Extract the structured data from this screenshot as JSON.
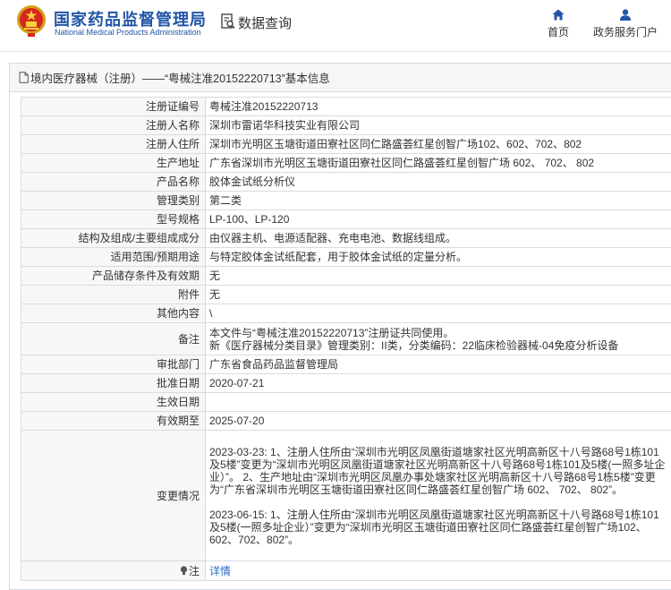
{
  "header": {
    "brand_cn": "国家药品监督管理局",
    "brand_en": "National Medical Products Administration",
    "page_heading": "数据查询",
    "nav": [
      {
        "label": "首页",
        "icon": "home-icon"
      },
      {
        "label": "政务服务门户",
        "icon": "user-icon"
      }
    ]
  },
  "panel": {
    "title": "境内医疗器械（注册）——“粤械注准20152220713”基本信息"
  },
  "fields": {
    "reg_no": {
      "label": "注册证编号",
      "value": "粤械注准20152220713"
    },
    "registrant": {
      "label": "注册人名称",
      "value": "深圳市雷诺华科技实业有限公司"
    },
    "registrant_addr": {
      "label": "注册人住所",
      "value": "深圳市光明区玉塘街道田寮社区同仁路盛荟红星创智广场102、602、702、802"
    },
    "production_addr": {
      "label": "生产地址",
      "value": "广东省深圳市光明区玉塘街道田寮社区同仁路盛荟红星创智广场 602、 702、 802"
    },
    "product_name": {
      "label": "产品名称",
      "value": "胶体金试纸分析仪"
    },
    "category": {
      "label": "管理类别",
      "value": "第二类"
    },
    "model": {
      "label": "型号规格",
      "value": "LP-100、LP-120"
    },
    "structure": {
      "label": "结构及组成/主要组成成分",
      "value": "由仪器主机、电源适配器、充电电池、数据线组成。"
    },
    "scope": {
      "label": "适用范围/预期用途",
      "value": "与特定胶体金试纸配套，用于胶体金试纸的定量分析。"
    },
    "storage": {
      "label": "产品储存条件及有效期",
      "value": "无"
    },
    "attachment": {
      "label": "附件",
      "value": "无"
    },
    "other": {
      "label": "其他内容",
      "value": "\\"
    },
    "remarks": {
      "label": "备注",
      "line1": "本文件与“粤械注准20152220713”注册证共同使用。",
      "line2": "新《医疗器械分类目录》管理类别：II类，分类编码：22临床检验器械-04免疫分析设备"
    },
    "approval_dept": {
      "label": "审批部门",
      "value": "广东省食品药品监督管理局"
    },
    "approval_date": {
      "label": "批准日期",
      "value": "2020-07-21"
    },
    "effective_date": {
      "label": "生效日期",
      "value": ""
    },
    "valid_until": {
      "label": "有效期至",
      "value": "2025-07-20"
    },
    "changes": {
      "label": "变更情况",
      "entry1": "2023-03-23: 1、注册人住所由“深圳市光明区凤凰街道塘家社区光明高新区十八号路68号1栋101及5楼”变更为“深圳市光明区凤凰街道塘家社区光明高新区十八号路68号1栋101及5楼(一照多址企业）”。 2、生产地址由“深圳市光明区凤凰办事处塘家社区光明高新区十八号路68号1栋5楼”变更为“广东省深圳市光明区玉塘街道田寮社区同仁路盛荟红星创智广场 602、 702、 802”。",
      "entry2": "2023-06-15: 1、注册人住所由“深圳市光明区凤凰街道塘家社区光明高新区十八号路68号1栋101及5楼(一照多址企业）”变更为“深圳市光明区玉塘街道田寮社区同仁路盛荟红星创智广场102、602、702、802”。"
    },
    "note": {
      "label": "注",
      "link": "详情",
      "icon": "lightbulb-icon"
    }
  }
}
